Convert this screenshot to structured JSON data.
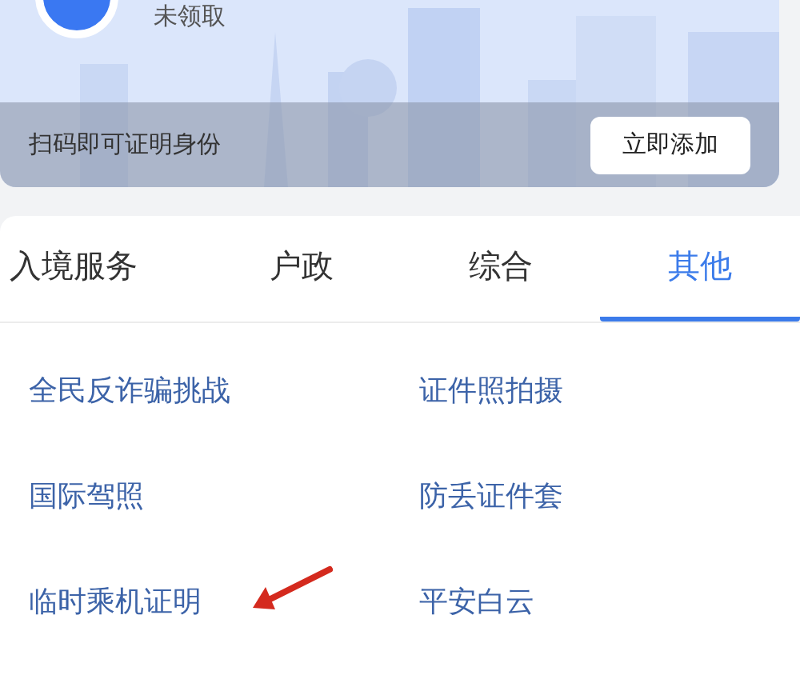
{
  "id_card": {
    "status": "未领取",
    "hint": "扫码即可证明身份",
    "add_button": "立即添加"
  },
  "tabs": [
    {
      "label": "入境服务",
      "selected": false
    },
    {
      "label": "户政",
      "selected": false
    },
    {
      "label": "综合",
      "selected": false
    },
    {
      "label": "其他",
      "selected": true
    }
  ],
  "services": [
    "全民反诈骗挑战",
    "证件照拍摄",
    "国际驾照",
    "防丢证件套",
    "临时乘机证明",
    "平安白云"
  ]
}
